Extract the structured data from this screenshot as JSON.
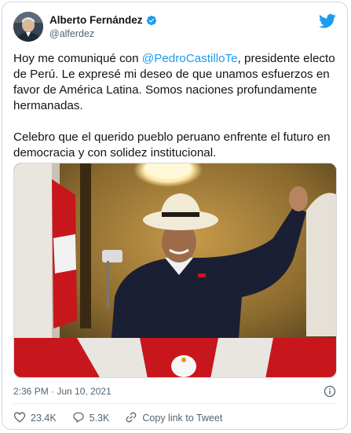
{
  "author": {
    "name": "Alberto Fernández",
    "handle": "@alferdez"
  },
  "tweet": {
    "line1_prefix": "Hoy me comuniqué con ",
    "mention": "@PedroCastilloTe",
    "line1_suffix": ", presidente electo de Perú. Le expresé mi deseo de que unamos esfuerzos en favor de América Latina. Somos naciones profundamente hermanadas.",
    "paragraph2": "Celebro que el querido pueblo peruano enfrente el futuro en democracia y con solidez institucional."
  },
  "meta": {
    "timestamp": "2:36 PM · Jun 10, 2021"
  },
  "actions": {
    "likes": "23.4K",
    "replies": "5.3K",
    "copy_link": "Copy link to Tweet"
  },
  "colors": {
    "accent": "#1d9bf0",
    "like": "#f91880",
    "muted": "#536471"
  },
  "icons": [
    "verified-badge-icon",
    "twitter-bird-icon",
    "info-icon",
    "heart-icon",
    "reply-icon",
    "link-icon"
  ]
}
